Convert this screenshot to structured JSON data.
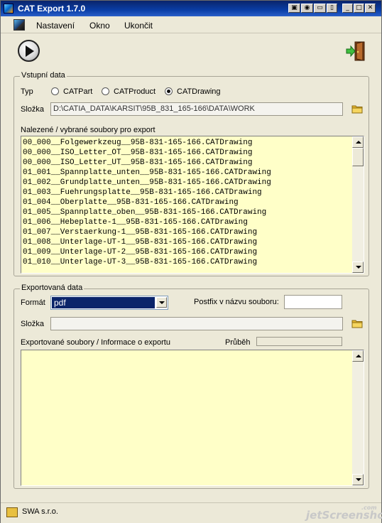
{
  "window": {
    "title": "CAT Export 1.7.0"
  },
  "menu": {
    "items": [
      "Nastavení",
      "Okno",
      "Ukončit"
    ]
  },
  "input_section": {
    "title": "Vstupní data",
    "type_label": "Typ",
    "types": [
      {
        "label": "CATPart",
        "selected": false
      },
      {
        "label": "CATProduct",
        "selected": false
      },
      {
        "label": "CATDrawing",
        "selected": true
      }
    ],
    "folder_label": "Složka",
    "folder_path": "D:\\CATIA_DATA\\KARSIT\\95B_831_165-166\\DATA\\WORK",
    "files_label": "Nalezené / vybrané soubory pro export",
    "files": [
      "00_000__Folgewerkzeug__95B-831-165-166.CATDrawing",
      "00_000__ISO_Letter_OT__95B-831-165-166.CATDrawing",
      "00_000__ISO_Letter_UT__95B-831-165-166.CATDrawing",
      "01_001__Spannplatte_unten__95B-831-165-166.CATDrawing",
      "01_002__Grundplatte_unten__95B-831-165-166.CATDrawing",
      "01_003__Fuehrungsplatte__95B-831-165-166.CATDrawing",
      "01_004__Oberplatte__95B-831-165-166.CATDrawing",
      "01_005__Spannplatte_oben__95B-831-165-166.CATDrawing",
      "01_006__Hebeplatte-1__95B-831-165-166.CATDrawing",
      "01_007__Verstaerkung-1__95B-831-165-166.CATDrawing",
      "01_008__Unterlage-UT-1__95B-831-165-166.CATDrawing",
      "01_009__Unterlage-UT-2__95B-831-165-166.CATDrawing",
      "01_010__Unterlage-UT-3__95B-831-165-166.CATDrawing"
    ]
  },
  "export_section": {
    "title": "Exportovaná data",
    "format_label": "Formát",
    "format_value": "pdf",
    "postfix_label": "Postfix v názvu souboru:",
    "postfix_value": "",
    "folder_label": "Složka",
    "folder_path": "",
    "info_label": "Exportované soubory / Informace o exportu",
    "progress_label": "Průběh",
    "progress_value": 0
  },
  "status": {
    "company": "SWA s.r.o."
  },
  "watermark": {
    "text": "jetScreenshot",
    "suffix": ".com"
  }
}
